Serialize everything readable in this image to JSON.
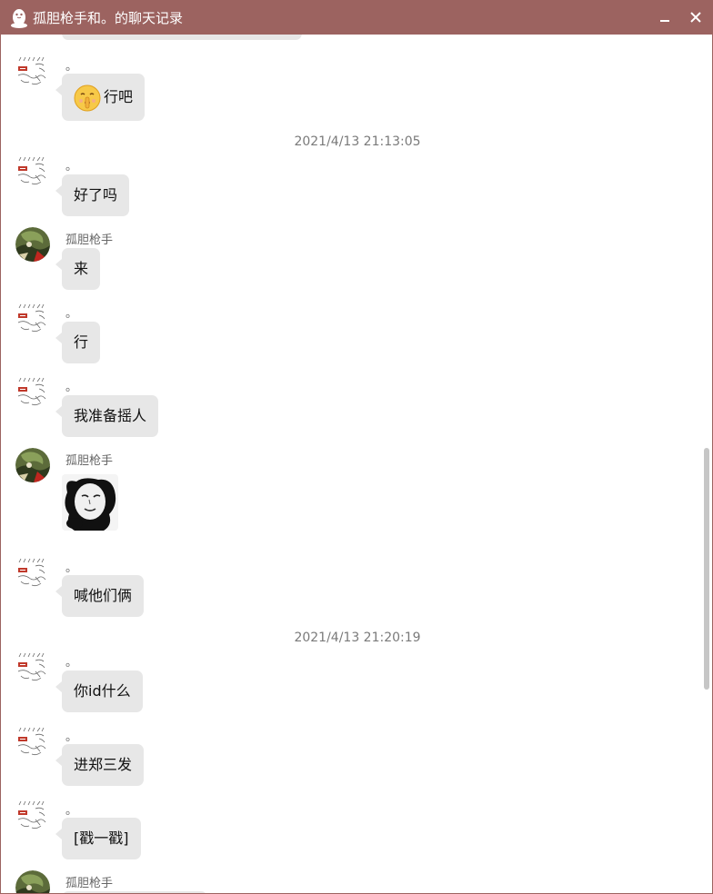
{
  "window": {
    "title": "孤胆枪手和。的聊天记录"
  },
  "controls": {
    "minimize": "—",
    "close": "✕"
  },
  "scroll": {
    "position_fraction": 0.98
  },
  "timestamps": [
    "2021/4/13 21:13:05",
    "2021/4/13 21:20:19"
  ],
  "messages": [
    {
      "sender": "。",
      "avatar": "sketch-avatar",
      "text": "行吧",
      "emoji": "shush-emoji"
    },
    {
      "sender": "。",
      "avatar": "sketch-avatar",
      "text": "好了吗"
    },
    {
      "sender": "孤胆枪手",
      "avatar": "photo-avatar",
      "text": "来"
    },
    {
      "sender": "。",
      "avatar": "sketch-avatar",
      "text": "行"
    },
    {
      "sender": "。",
      "avatar": "sketch-avatar",
      "text": "我准备摇人"
    },
    {
      "sender": "孤胆枪手",
      "avatar": "photo-avatar",
      "sticker": "panda-meme-sticker"
    },
    {
      "sender": "。",
      "avatar": "sketch-avatar",
      "text": "喊他们俩"
    },
    {
      "sender": "。",
      "avatar": "sketch-avatar",
      "text": "你id什么"
    },
    {
      "sender": "。",
      "avatar": "sketch-avatar",
      "text": "进郑三发"
    },
    {
      "sender": "。",
      "avatar": "sketch-avatar",
      "text": "[戳一戳]"
    },
    {
      "sender": "孤胆枪手",
      "avatar": "photo-avatar"
    }
  ]
}
